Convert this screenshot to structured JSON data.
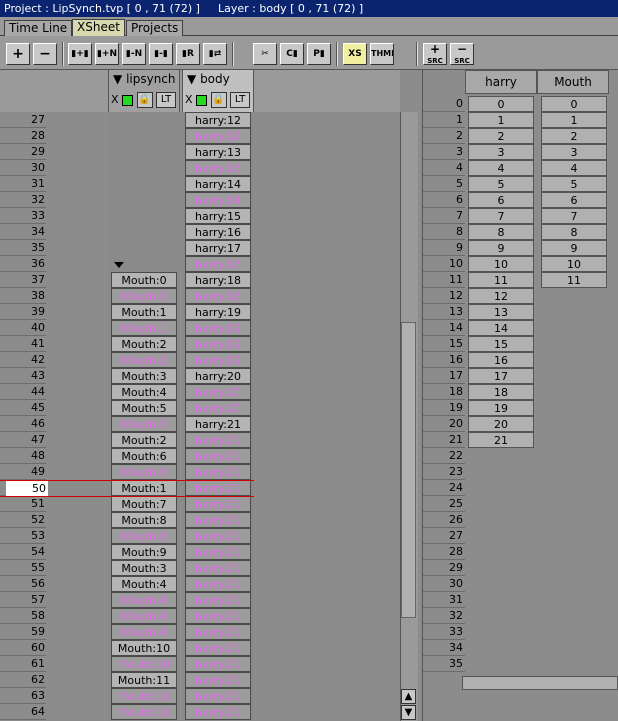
{
  "titlebar": {
    "project": "Project : LipSynch.tvp [ 0 , 71  (72) ]",
    "layer": "Layer : body [ 0 , 71  (72) ]"
  },
  "tabs": [
    {
      "label": "Time Line"
    },
    {
      "label": "XSheet"
    },
    {
      "label": "Projects"
    }
  ],
  "toolbar": {
    "xs_label": "XS",
    "thmb_label": "THMB",
    "src_label": "SRC"
  },
  "columns": [
    {
      "name": "lipsynch",
      "x_label": "X",
      "lt_label": "LT"
    },
    {
      "name": "body",
      "x_label": "X",
      "lt_label": "LT"
    }
  ],
  "frame_numbers": [
    "27",
    "28",
    "29",
    "30",
    "31",
    "32",
    "33",
    "34",
    "35",
    "36",
    "37",
    "38",
    "39",
    "40",
    "41",
    "42",
    "43",
    "44",
    "45",
    "46",
    "47",
    "48",
    "49",
    "50",
    "51",
    "52",
    "53",
    "54",
    "55",
    "56",
    "57",
    "58",
    "59",
    "60",
    "61",
    "62",
    "63",
    "64"
  ],
  "current_frame": "50",
  "lipsynch_cells": [
    {
      "t": "",
      "k": "e"
    },
    {
      "t": "",
      "k": "e"
    },
    {
      "t": "",
      "k": "e"
    },
    {
      "t": "",
      "k": "e"
    },
    {
      "t": "",
      "k": "e"
    },
    {
      "t": "",
      "k": "e"
    },
    {
      "t": "",
      "k": "e"
    },
    {
      "t": "",
      "k": "e"
    },
    {
      "t": "",
      "k": "e"
    },
    {
      "t": "",
      "k": "e"
    },
    {
      "t": "Mouth:0",
      "k": "k"
    },
    {
      "t": "Mouth:0",
      "k": "h"
    },
    {
      "t": "Mouth:1",
      "k": "k"
    },
    {
      "t": "Mouth:1",
      "k": "h"
    },
    {
      "t": "Mouth:2",
      "k": "k"
    },
    {
      "t": "Mouth:2",
      "k": "h"
    },
    {
      "t": "Mouth:3",
      "k": "k"
    },
    {
      "t": "Mouth:4",
      "k": "k"
    },
    {
      "t": "Mouth:5",
      "k": "k"
    },
    {
      "t": "Mouth:5",
      "k": "h"
    },
    {
      "t": "Mouth:2",
      "k": "k"
    },
    {
      "t": "Mouth:6",
      "k": "k"
    },
    {
      "t": "Mouth:6",
      "k": "h"
    },
    {
      "t": "Mouth:1",
      "k": "k"
    },
    {
      "t": "Mouth:7",
      "k": "k"
    },
    {
      "t": "Mouth:8",
      "k": "k"
    },
    {
      "t": "Mouth:8",
      "k": "h"
    },
    {
      "t": "Mouth:9",
      "k": "k"
    },
    {
      "t": "Mouth:3",
      "k": "k"
    },
    {
      "t": "Mouth:4",
      "k": "k"
    },
    {
      "t": "Mouth:4",
      "k": "h"
    },
    {
      "t": "Mouth:4",
      "k": "h"
    },
    {
      "t": "Mouth:4",
      "k": "h"
    },
    {
      "t": "Mouth:10",
      "k": "k"
    },
    {
      "t": "Mouth:10",
      "k": "h"
    },
    {
      "t": "Mouth:11",
      "k": "k"
    },
    {
      "t": "Mouth:11",
      "k": "h"
    },
    {
      "t": "Mouth:11",
      "k": "h"
    }
  ],
  "body_cells": [
    {
      "t": "harry:12",
      "k": "k"
    },
    {
      "t": "harry:12",
      "k": "h"
    },
    {
      "t": "harry:13",
      "k": "k"
    },
    {
      "t": "harry:13",
      "k": "h"
    },
    {
      "t": "harry:14",
      "k": "k"
    },
    {
      "t": "harry:14",
      "k": "h"
    },
    {
      "t": "harry:15",
      "k": "k"
    },
    {
      "t": "harry:16",
      "k": "k"
    },
    {
      "t": "harry:17",
      "k": "k"
    },
    {
      "t": "harry:17",
      "k": "h"
    },
    {
      "t": "harry:18",
      "k": "k"
    },
    {
      "t": "harry:18",
      "k": "h"
    },
    {
      "t": "harry:19",
      "k": "k"
    },
    {
      "t": "harry:19",
      "k": "h"
    },
    {
      "t": "harry:19",
      "k": "h"
    },
    {
      "t": "harry:19",
      "k": "h"
    },
    {
      "t": "harry:20",
      "k": "k"
    },
    {
      "t": "harry:20",
      "k": "h"
    },
    {
      "t": "harry:20",
      "k": "h"
    },
    {
      "t": "harry:21",
      "k": "k"
    },
    {
      "t": "harry:21",
      "k": "h"
    },
    {
      "t": "harry:21",
      "k": "h"
    },
    {
      "t": "harry:21",
      "k": "h"
    },
    {
      "t": "harry:21",
      "k": "h"
    },
    {
      "t": "harry:21",
      "k": "h"
    },
    {
      "t": "harry:21",
      "k": "h"
    },
    {
      "t": "harry:21",
      "k": "h"
    },
    {
      "t": "harry:21",
      "k": "h"
    },
    {
      "t": "harry:21",
      "k": "h"
    },
    {
      "t": "harry:21",
      "k": "h"
    },
    {
      "t": "harry:21",
      "k": "h"
    },
    {
      "t": "harry:21",
      "k": "h"
    },
    {
      "t": "harry:21",
      "k": "h"
    },
    {
      "t": "harry:21",
      "k": "h"
    },
    {
      "t": "harry:21",
      "k": "h"
    },
    {
      "t": "harry:21",
      "k": "h"
    },
    {
      "t": "harry:21",
      "k": "h"
    },
    {
      "t": "harry:21",
      "k": "h"
    }
  ],
  "sources": {
    "headers": [
      "harry",
      "Mouth"
    ],
    "row_numbers": [
      "0",
      "1",
      "2",
      "3",
      "4",
      "5",
      "6",
      "7",
      "8",
      "9",
      "10",
      "11",
      "12",
      "13",
      "14",
      "15",
      "16",
      "17",
      "18",
      "19",
      "20",
      "21",
      "22",
      "23",
      "24",
      "25",
      "26",
      "27",
      "28",
      "29",
      "30",
      "31",
      "32",
      "33",
      "34",
      "35"
    ],
    "harry": [
      "0",
      "1",
      "2",
      "3",
      "4",
      "5",
      "6",
      "7",
      "8",
      "9",
      "10",
      "11",
      "12",
      "13",
      "14",
      "15",
      "16",
      "17",
      "18",
      "19",
      "20",
      "21"
    ],
    "mouth": [
      "0",
      "1",
      "2",
      "3",
      "4",
      "5",
      "6",
      "7",
      "8",
      "9",
      "10",
      "11"
    ]
  },
  "colors": {
    "hold_text": "#e070e8",
    "key_bg": "#b4b4b4",
    "cursor_line": "#d00000",
    "active_tab": "#d8d8b0"
  }
}
